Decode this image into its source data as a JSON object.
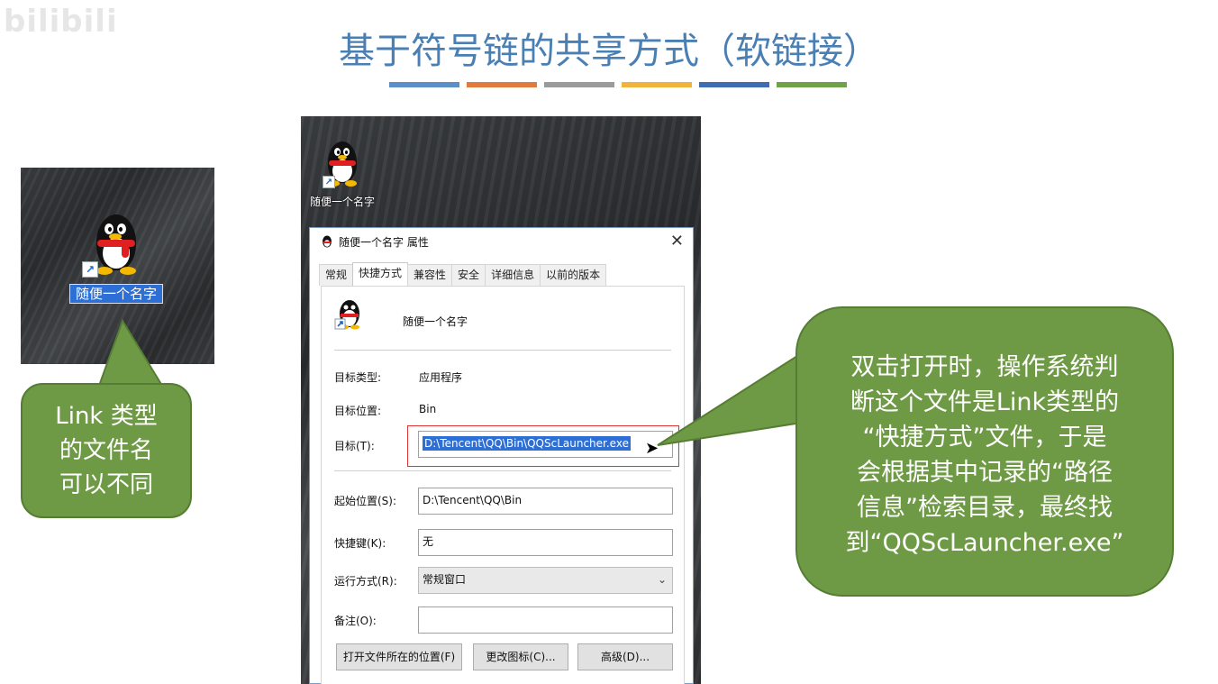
{
  "watermark": "bilibili",
  "title": "基于符号链的共享方式（软链接）",
  "bar_colors": [
    "#5b8fc7",
    "#e07a3f",
    "#9b9b9b",
    "#f0b43c",
    "#3f6db3",
    "#6fa34a"
  ],
  "left_desktop": {
    "icon_label": "随便一个名字"
  },
  "left_callout": {
    "lines": [
      "Link 类型",
      "的文件名",
      "可以不同"
    ]
  },
  "center_desktop": {
    "icon_label": "随便一个名字"
  },
  "dialog": {
    "title": "随便一个名字 属性",
    "close": "✕",
    "tabs": [
      "常规",
      "快捷方式",
      "兼容性",
      "安全",
      "详细信息",
      "以前的版本"
    ],
    "file_name": "随便一个名字",
    "target_type_label": "目标类型:",
    "target_type_value": "应用程序",
    "target_location_label": "目标位置:",
    "target_location_value": "Bin",
    "target_label": "目标(T):",
    "target_value": "D:\\Tencent\\QQ\\Bin\\QQScLauncher.exe",
    "start_in_label": "起始位置(S):",
    "start_in_value": "D:\\Tencent\\QQ\\Bin",
    "hotkey_label": "快捷键(K):",
    "hotkey_value": "无",
    "run_label": "运行方式(R):",
    "run_value": "常规窗口",
    "comment_label": "备注(O):",
    "comment_value": "",
    "btn_open_location": "打开文件所在的位置(F)",
    "btn_change_icon": "更改图标(C)...",
    "btn_advanced": "高级(D)..."
  },
  "right_callout": {
    "lines": [
      "双击打开时，操作系统判",
      "断这个文件是Link类型的",
      "“快捷方式”文件，于是",
      "会根据其中记录的“路径",
      "信息”检索目录，最终找",
      "到“QQScLauncher.exe”"
    ]
  }
}
